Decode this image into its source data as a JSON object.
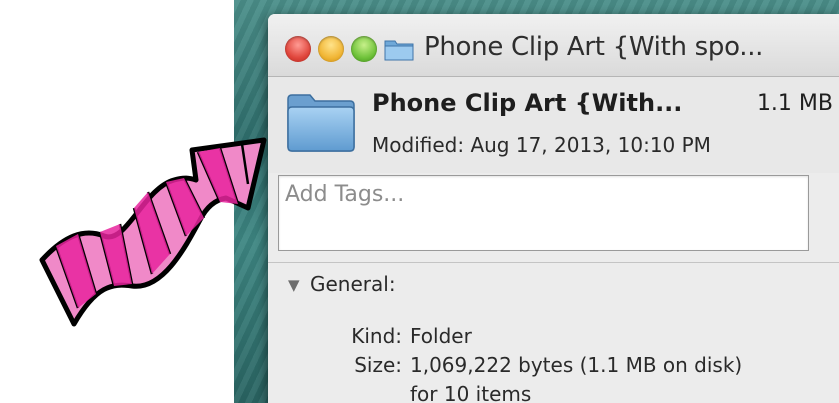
{
  "window": {
    "title": "Phone Clip Art {With spo...",
    "controls": {
      "close_icon": "close-circle",
      "minimize_icon": "minimize-circle",
      "zoom_icon": "zoom-circle"
    },
    "title_icon": "folder-icon"
  },
  "header": {
    "icon": "folder-icon",
    "name": "Phone Clip Art {With...",
    "size": "1.1 MB",
    "modified": "Modified: Aug 17, 2013, 10:10 PM"
  },
  "tags": {
    "placeholder": "Add Tags..."
  },
  "general": {
    "label": "General:",
    "rows": [
      {
        "label": "Kind:",
        "value": "Folder"
      },
      {
        "label": "Size:",
        "value": "1,069,222 bytes (1.1 MB on disk)"
      },
      {
        "label": "",
        "value": "for 10 items"
      }
    ]
  },
  "annotation": {
    "icon": "pink-striped-arrow",
    "colors": {
      "fill_dark": "#e8259e",
      "fill_light": "#f089c8",
      "outline": "#000000"
    }
  }
}
